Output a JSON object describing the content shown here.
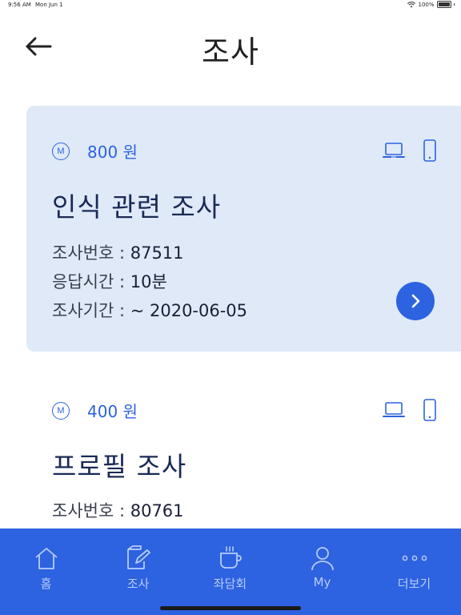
{
  "status_bar": {
    "time": "9:56 AM",
    "date": "Mon Jun 1",
    "battery": "100%"
  },
  "header": {
    "title": "조사"
  },
  "surveys": [
    {
      "reward": "800 원",
      "badge": "M",
      "title": "인식 관련 조사",
      "number_label": "조사번호 : ",
      "number_value": "87511",
      "time_label": "응답시간 : ",
      "time_value": "10분",
      "period_label": "조사기간 : ",
      "period_value": "~ 2020-06-05"
    },
    {
      "reward": "400 원",
      "badge": "M",
      "title": "프로필 조사",
      "number_label": "조사번호 : ",
      "number_value": "80761"
    }
  ],
  "tabs": [
    {
      "label": "홈",
      "icon": "home-icon"
    },
    {
      "label": "조사",
      "icon": "survey-edit-icon"
    },
    {
      "label": "좌담회",
      "icon": "coffee-cup-icon"
    },
    {
      "label": "My",
      "icon": "person-icon"
    },
    {
      "label": "더보기",
      "icon": "more-dots-icon"
    }
  ],
  "colors": {
    "accent": "#2d62e0",
    "card_bg": "#dfe9f8",
    "tab_label": "#b9cdfb"
  }
}
